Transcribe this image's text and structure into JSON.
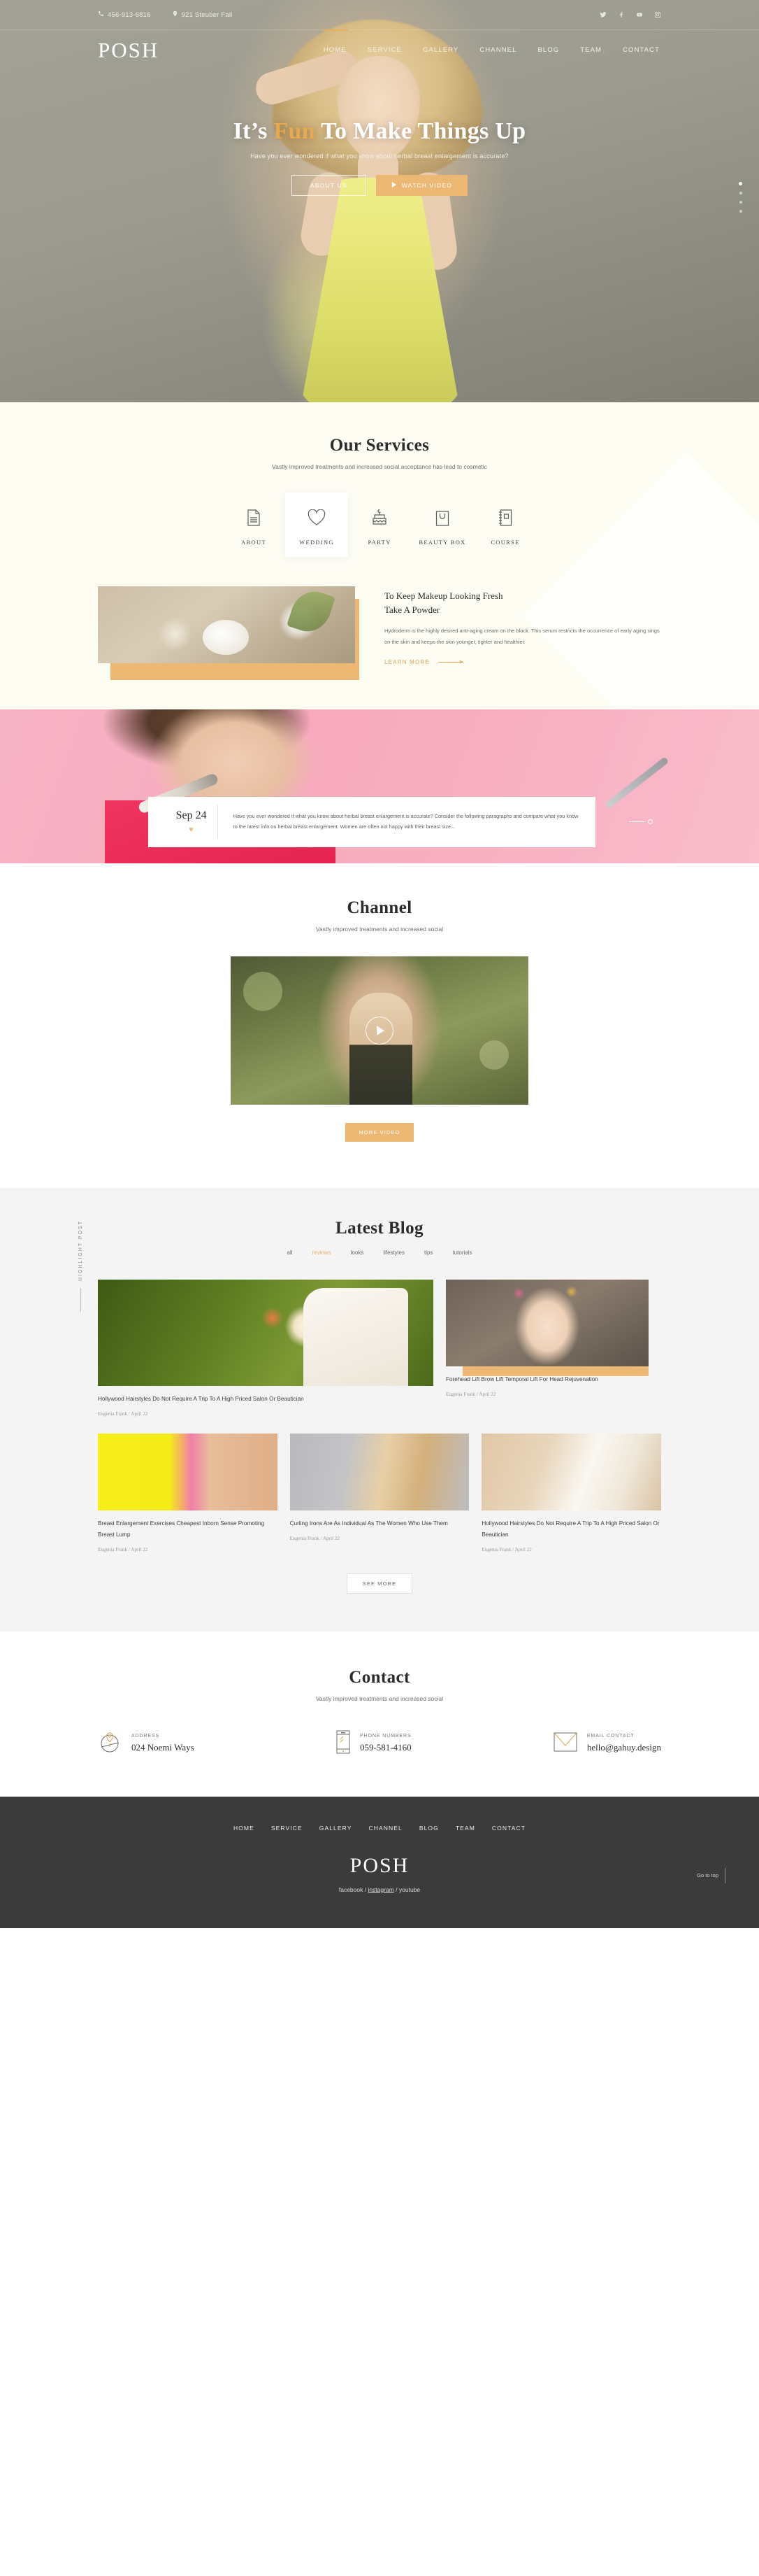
{
  "topbar": {
    "phone": "456-913-6816",
    "address": "921 Steuber Fall",
    "socials": [
      "twitter-icon",
      "facebook-icon",
      "youtube-icon",
      "instagram-icon"
    ]
  },
  "header": {
    "logo": "POSH",
    "nav": [
      {
        "label": "HOME",
        "active": true
      },
      {
        "label": "SERVICE",
        "active": false
      },
      {
        "label": "GALLERY",
        "active": false
      },
      {
        "label": "CHANNEL",
        "active": false
      },
      {
        "label": "BLOG",
        "active": false
      },
      {
        "label": "TEAM",
        "active": false
      },
      {
        "label": "CONTACT",
        "active": false
      }
    ]
  },
  "hero": {
    "title_part1": "It’s ",
    "title_highlight": "Fun",
    "title_part2": " To Make Things Up",
    "subtitle": "Have you ever wondered if what you know about herbal breast enlargement is accurate?",
    "btn_primary": "ABOUT US",
    "btn_secondary": "WATCH VIDEO",
    "slide_dots": 4,
    "active_dot": 1,
    "accent_color": "#e8a94e"
  },
  "services": {
    "title": "Our Services",
    "subtitle": "Vastly improved treatments and increased social acceptance has lead to cosmetic",
    "tabs": [
      {
        "label": "ABOUT",
        "icon": "document-icon",
        "active": false
      },
      {
        "label": "WEDDING",
        "icon": "heart-icon",
        "active": true
      },
      {
        "label": "PARTY",
        "icon": "cake-icon",
        "active": false
      },
      {
        "label": "BEAUTY BOX",
        "icon": "bag-icon",
        "active": false
      },
      {
        "label": "COURSE",
        "icon": "notebook-icon",
        "active": false
      }
    ],
    "panel": {
      "heading_line1": "To Keep Makeup Looking Fresh",
      "heading_line2": "Take A Powder",
      "body": "Hydroderm is the highly desired anti-aging cream on the block. This serum restricts the occurrence of early aging sings on the skin and keeps the skin younger, tighter and healthier.",
      "cta": "LEARN MORE"
    }
  },
  "banner": {
    "date": "Sep 24",
    "heart": "♥",
    "text": "Have you ever wondered if what you know about herbal breast enlargement is accurate? Consider the following paragraphs and compare what you know to the latest info on herbal breast enlargement. Women are often not happy with their breast size..."
  },
  "channel": {
    "title": "Channel",
    "subtitle": "Vastly improved treatments and increased social",
    "play": "play-icon",
    "button": "MORE VIDEO"
  },
  "blog": {
    "title": "Latest Blog",
    "filters": [
      {
        "label": "all",
        "active": false
      },
      {
        "label": "reviews",
        "active": true
      },
      {
        "label": "looks",
        "active": false
      },
      {
        "label": "lifestyles",
        "active": false
      },
      {
        "label": "tips",
        "active": false
      },
      {
        "label": "tutorials",
        "active": false
      }
    ],
    "highlight_label": "HIGHLIGHT POST",
    "posts": [
      {
        "title": "Hollywood Hairstyles Do Not Require A Trip To A High Priced Salon Or Beautician",
        "meta": "Eugenia Frank / April 22"
      },
      {
        "title": "Forehead Lift Brow Lift Temporal Lift For Head Rejuvenation",
        "meta": "Eugenia Frank / April 22"
      },
      {
        "title": "Breast Enlargement Exercises Cheapest Inborn Sense Promoting Breast Lump",
        "meta": "Eugenia Frank / April 22"
      },
      {
        "title": "Curling Irons Are As Individual As The Women Who Use Them",
        "meta": "Eugenia Frank / April 22"
      },
      {
        "title": "Hollywood Hairstyles Do Not Require A Trip To A High Priced Salon Or Beautician",
        "meta": "Eugenia Frank / April 22"
      }
    ],
    "button": "SEE MORE"
  },
  "contact": {
    "title": "Contact",
    "subtitle": "Vastly improved treatments and increased social",
    "items": [
      {
        "icon": "location-pin-icon",
        "label": "ADDRESS",
        "value": "024 Noemi Ways"
      },
      {
        "icon": "mobile-phone-icon",
        "label": "PHONE NUMBERS",
        "value": "059-581-4160"
      },
      {
        "icon": "envelope-icon",
        "label": "EMAIL CONTACT",
        "value": "hello@gahuy.design"
      }
    ]
  },
  "footer": {
    "nav": [
      "HOME",
      "SERVICE",
      "GALLERY",
      "CHANNEL",
      "BLOG",
      "TEAM",
      "CONTACT"
    ],
    "logo": "POSH",
    "social": {
      "facebook": "facebook",
      "sep1": " / ",
      "instagram": "instagram",
      "sep2": " / ",
      "youtube": "youtube"
    },
    "go_top": "Go to top"
  }
}
